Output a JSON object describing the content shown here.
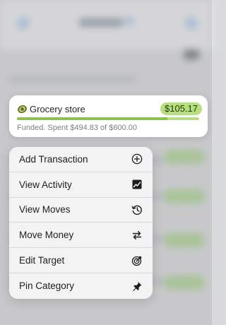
{
  "category": {
    "emoji_icon": "avocado-icon",
    "name": "Grocery store",
    "available": "$105.17",
    "status": "Funded. Spent $494.83 of $600.00",
    "spent_fraction": 0.825,
    "colors": {
      "pill": "#b6e07d",
      "bar_track": "#b7dd86",
      "bar_fill": "#8dc153"
    }
  },
  "menu": {
    "items": [
      {
        "label": "Add Transaction",
        "icon": "plus-circle-icon"
      },
      {
        "label": "View Activity",
        "icon": "activity-chart-icon"
      },
      {
        "label": "View Moves",
        "icon": "history-clock-icon"
      },
      {
        "label": "Move Money",
        "icon": "swap-arrows-icon"
      },
      {
        "label": "Edit Target",
        "icon": "target-icon"
      },
      {
        "label": "Pin Category",
        "icon": "pin-icon"
      }
    ]
  }
}
